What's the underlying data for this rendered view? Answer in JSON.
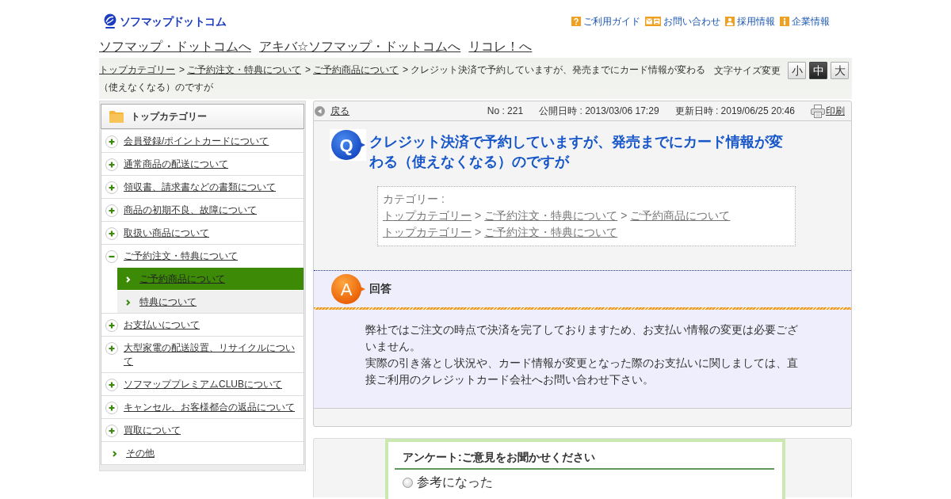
{
  "header": {
    "logo": "ソフマップドットコム",
    "utility_links": [
      {
        "label": "ご利用ガイド",
        "kind": "guide"
      },
      {
        "label": "お問い合わせ",
        "kind": "contact"
      },
      {
        "label": "採用情報",
        "kind": "recruit"
      },
      {
        "label": "企業情報",
        "kind": "company"
      }
    ]
  },
  "site_links": [
    "ソフマップ・ドットコムへ",
    "アキバ☆ソフマップ・ドットコムへ",
    "リコレ！へ"
  ],
  "breadcrumb": {
    "separator": ">",
    "links": [
      "トップカテゴリー",
      "ご予約注文・特典について",
      "ご予約商品について"
    ],
    "current": "クレジット決済で予約していますが、発売までにカード情報が変わる（使えなくなる）のですが"
  },
  "font_size": {
    "label": "文字サイズ変更",
    "options": [
      {
        "label": "小",
        "selected": false
      },
      {
        "label": "中",
        "selected": true
      },
      {
        "label": "大",
        "selected": false
      }
    ]
  },
  "sidebar": {
    "title": "トップカテゴリー",
    "items": [
      {
        "label": "会員登録/ポイントカードについて",
        "kind": "folder",
        "expanded": false,
        "selected": false
      },
      {
        "label": "通常商品の配送について",
        "kind": "folder",
        "expanded": false,
        "selected": false
      },
      {
        "label": "領収書、請求書などの書類について",
        "kind": "folder",
        "expanded": false,
        "selected": false
      },
      {
        "label": "商品の初期不良、故障について",
        "kind": "folder",
        "expanded": false,
        "selected": false
      },
      {
        "label": "取扱い商品について",
        "kind": "folder",
        "expanded": false,
        "selected": false
      },
      {
        "label": "ご予約注文・特典について",
        "kind": "folder",
        "expanded": true,
        "selected": false,
        "children": [
          {
            "label": "ご予約商品について",
            "kind": "leaf",
            "selected": true
          },
          {
            "label": "特典について",
            "kind": "leaf",
            "selected": false
          }
        ]
      },
      {
        "label": "お支払いについて",
        "kind": "folder",
        "expanded": false,
        "selected": false
      },
      {
        "label": "大型家電の配送設置、リサイクルについて",
        "kind": "folder",
        "expanded": false,
        "selected": false
      },
      {
        "label": "ソフマッププレミアムCLUBについて",
        "kind": "folder",
        "expanded": false,
        "selected": false
      },
      {
        "label": "キャンセル、お客様都合の返品について",
        "kind": "folder",
        "expanded": false,
        "selected": false
      },
      {
        "label": "買取について",
        "kind": "folder",
        "expanded": false,
        "selected": false
      },
      {
        "label": "その他",
        "kind": "leaf",
        "selected": false
      }
    ]
  },
  "question": {
    "back": "戻る",
    "number": "No : 221",
    "published": "公開日時 : 2013/03/06 17:29",
    "updated": "更新日時 : 2019/06/25 20:46",
    "print": "印刷",
    "badge": "Q",
    "title": "クレジット決済で予約していますが、発売までにカード情報が変わる（使えなくなる）のですが",
    "category_label": "カテゴリー :",
    "separator": ">",
    "category_paths": [
      [
        "トップカテゴリー",
        "ご予約注文・特典について",
        "ご予約商品について"
      ],
      [
        "トップカテゴリー",
        "ご予約注文・特典について"
      ]
    ]
  },
  "answer": {
    "badge": "A",
    "heading": "回答",
    "paragraphs": [
      "弊社ではご注文の時点で決済を完了しておりますため、お支払い情報の変更は必要ございません。",
      "実際の引き落とし状況や、カード情報が変更となった際のお支払いに関しましては、直接ご利用のクレジットカード会社へお問い合わせ下さい。"
    ]
  },
  "survey": {
    "title": "アンケート:ご意見をお聞かせください",
    "options": [
      {
        "label": "参考になった",
        "selected": false
      }
    ]
  }
}
